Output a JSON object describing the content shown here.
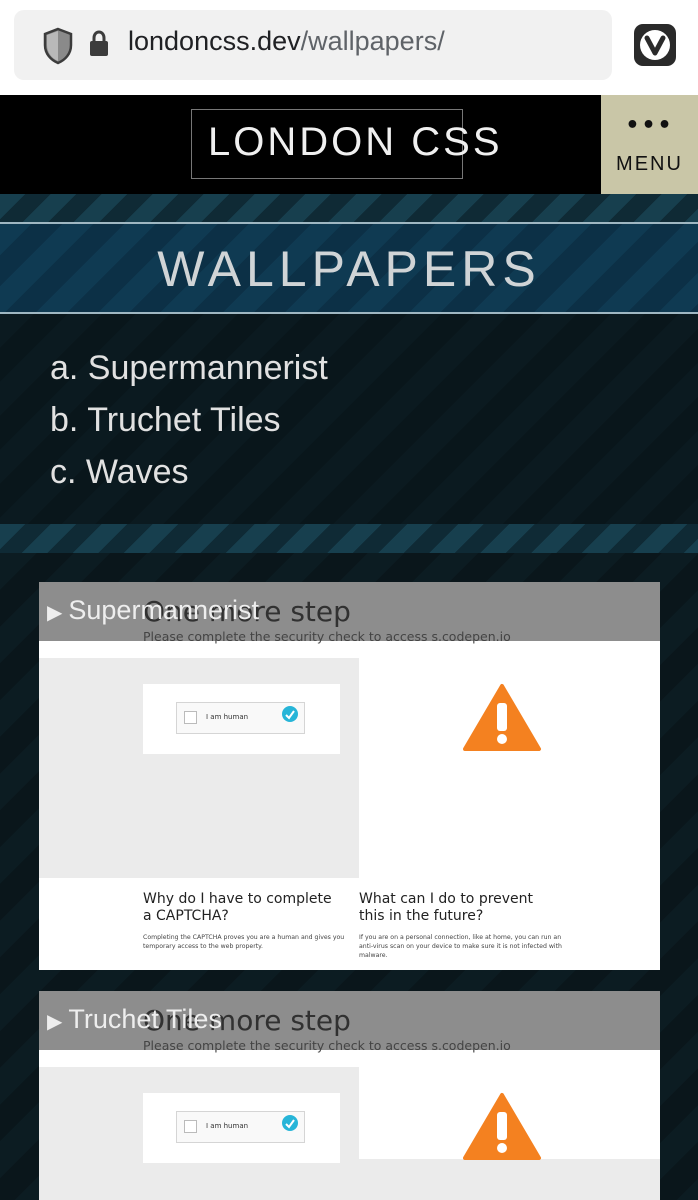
{
  "browser": {
    "url_host": "londoncss.dev",
    "url_path": "/wallpapers/",
    "icons": [
      "shield-icon",
      "lock-icon",
      "vivaldi-icon"
    ]
  },
  "header": {
    "logo": "LONDON CSS",
    "menu_dots": "•••",
    "menu_label": "MENU"
  },
  "page": {
    "title": "WALLPAPERS"
  },
  "toc": {
    "items": [
      "a. Supermannerist",
      "b. Truchet Tiles",
      "c. Waves"
    ]
  },
  "embeds": [
    {
      "summary": "Supermannerist",
      "heading": "One more step",
      "subheading": "Please complete the security check to access s.codepen.io",
      "captcha_label": "I am human",
      "captcha_brand": "hCaptcha",
      "captcha_links": "Privacy - Terms",
      "faq": [
        {
          "title": "Why do I have to complete a CAPTCHA?",
          "body": "Completing the CAPTCHA proves you are a human and gives you temporary access to the web property."
        },
        {
          "title": "What can I do to prevent this in the future?",
          "body": "If you are on a personal connection, like at home, you can run an anti-virus scan on your device to make sure it is not infected with malware."
        }
      ]
    },
    {
      "summary": "Truchet Tiles",
      "heading": "One more step",
      "subheading": "Please complete the security check to access s.codepen.io",
      "captcha_label": "I am human",
      "captcha_brand": "hCaptcha",
      "captcha_links": "Privacy - Terms"
    }
  ],
  "colors": {
    "menu_bg": "#c9c6a7",
    "title_band": "#0f3a52",
    "warning": "#f48120"
  }
}
